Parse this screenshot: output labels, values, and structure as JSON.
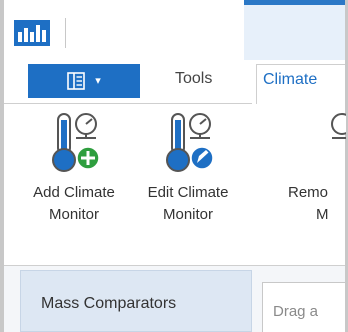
{
  "tabs": {
    "tools": "Tools",
    "climate": "Climate"
  },
  "ribbon": {
    "add_line1": "Add Climate",
    "add_line2": "Monitor",
    "edit_line1": "Edit Climate",
    "edit_line2": "Monitor",
    "remove_line1": "Remo",
    "remove_line2": "M"
  },
  "nav": {
    "item": "Mass Comparators"
  },
  "grid": {
    "drag_hint": "Drag a"
  },
  "colors": {
    "accent": "#1e6fc4",
    "add_badge": "#2e9e3e",
    "edit_badge": "#1e6fc4"
  }
}
